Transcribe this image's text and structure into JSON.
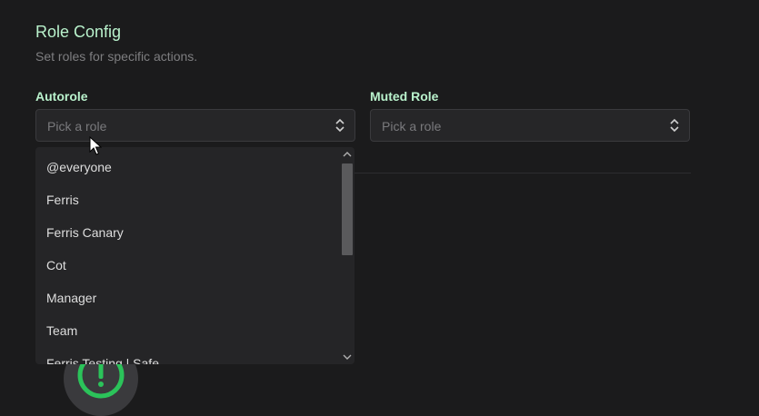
{
  "section": {
    "title": "Role Config",
    "subtitle": "Set roles for specific actions."
  },
  "autorole": {
    "label": "Autorole",
    "placeholder": "Pick a role"
  },
  "muted_role": {
    "label": "Muted Role",
    "placeholder": "Pick a role"
  },
  "dropdown": {
    "options": [
      "@everyone",
      "Ferris",
      "Ferris Canary",
      "Cot",
      "Manager",
      "Team",
      "Ferris Testing | Safe"
    ]
  },
  "icons": {
    "select_chevron": "chevron-updown-icon",
    "scroll_up": "chevron-up-icon",
    "scroll_down": "chevron-down-icon",
    "alert": "alert-circle-icon",
    "cursor": "mouse-pointer-icon"
  },
  "colors": {
    "accent": "#b9f2cc",
    "alert_green": "#2bc35a"
  }
}
